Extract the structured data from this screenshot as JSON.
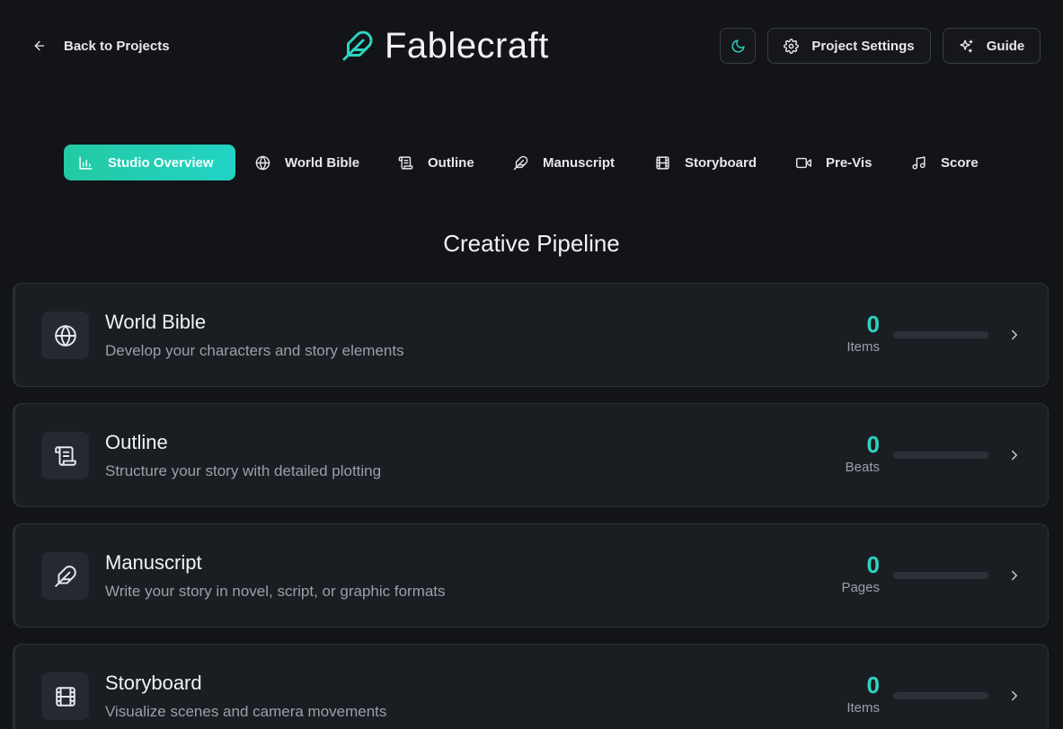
{
  "header": {
    "back_label": "Back to Projects",
    "brand": "Fablecraft",
    "settings_label": "Project Settings",
    "guide_label": "Guide"
  },
  "colors": {
    "accent": "#2bd4c0",
    "tab_gradient_start": "#23c9a3",
    "background": "#121418",
    "card": "#1a1d22"
  },
  "tabs": [
    {
      "label": "Studio Overview",
      "icon": "bar-chart-icon",
      "active": true
    },
    {
      "label": "World Bible",
      "icon": "globe-icon"
    },
    {
      "label": "Outline",
      "icon": "scroll-icon"
    },
    {
      "label": "Manuscript",
      "icon": "feather-icon"
    },
    {
      "label": "Storyboard",
      "icon": "film-icon"
    },
    {
      "label": "Pre-Vis",
      "icon": "video-icon"
    },
    {
      "label": "Score",
      "icon": "music-icon"
    }
  ],
  "section_title": "Creative Pipeline",
  "cards": [
    {
      "title": "World Bible",
      "description": "Develop your characters and story elements",
      "value": "0",
      "unit": "Items",
      "progress": 0,
      "icon": "globe-icon"
    },
    {
      "title": "Outline",
      "description": "Structure your story with detailed plotting",
      "value": "0",
      "unit": "Beats",
      "progress": 0,
      "icon": "scroll-icon"
    },
    {
      "title": "Manuscript",
      "description": "Write your story in novel, script, or graphic formats",
      "value": "0",
      "unit": "Pages",
      "progress": 0,
      "icon": "feather-icon"
    },
    {
      "title": "Storyboard",
      "description": "Visualize scenes and camera movements",
      "value": "0",
      "unit": "Items",
      "progress": 0,
      "icon": "film-icon"
    }
  ]
}
